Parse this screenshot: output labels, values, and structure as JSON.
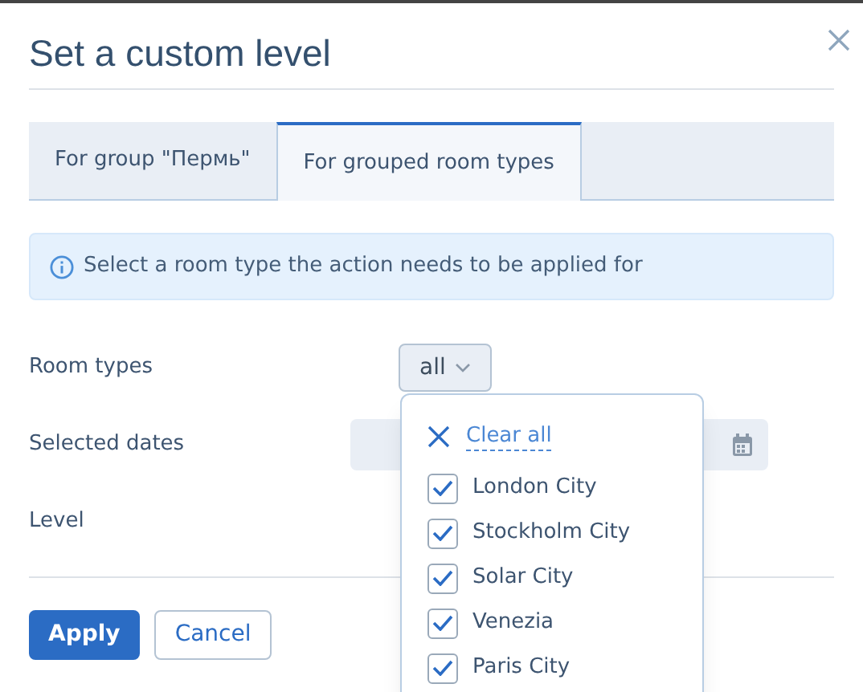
{
  "dialog": {
    "title": "Set a custom level"
  },
  "tabs": [
    {
      "label": "For group \"Пермь\"",
      "selected": false
    },
    {
      "label": "For grouped room types",
      "selected": true
    }
  ],
  "info": {
    "text": "Select a room type the action needs to be applied for"
  },
  "fields": [
    {
      "label": "Room types",
      "kind": "dropdown",
      "value": "all"
    },
    {
      "label": "Selected dates",
      "kind": "date"
    },
    {
      "label": "Level",
      "kind": "empty"
    }
  ],
  "dropdown": {
    "clear_label": "Clear all",
    "options": [
      {
        "label": "London City",
        "checked": true
      },
      {
        "label": "Stockholm City",
        "checked": true
      },
      {
        "label": "Solar City",
        "checked": true
      },
      {
        "label": "Venezia",
        "checked": true
      },
      {
        "label": "Paris City",
        "checked": true
      }
    ]
  },
  "buttons": [
    {
      "label": "Apply",
      "kind": "primary"
    },
    {
      "label": "Cancel",
      "kind": "secondary"
    }
  ]
}
